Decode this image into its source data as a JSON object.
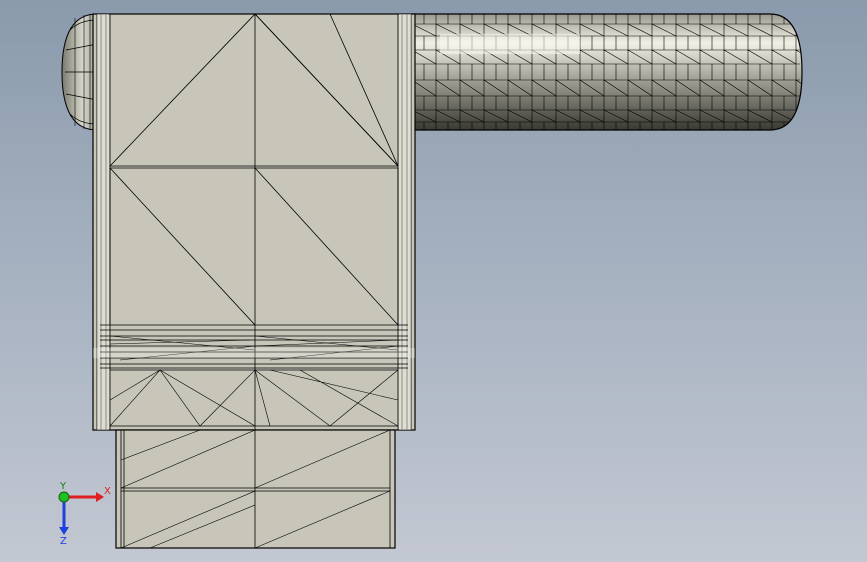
{
  "viewport": {
    "mode": "wireframe-shaded",
    "background_top": "#8a9aac",
    "background_bottom": "#c3c8d2"
  },
  "model": {
    "body_color": "#c7c6b9",
    "edge_color": "#000000",
    "handle_light": "#e8e8dc",
    "handle_dark": "#5a5a52"
  },
  "triad": {
    "x_label": "X",
    "y_label": "Y",
    "z_label": "Z",
    "x_color": "#e02020",
    "y_color": "#20c020",
    "z_color": "#2040e0"
  }
}
